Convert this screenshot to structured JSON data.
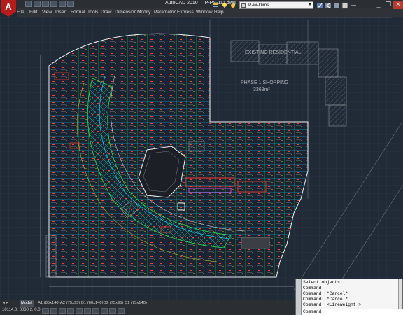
{
  "app": {
    "logo_letter": "A",
    "title": "AutoCAD 2010",
    "file": "P-PS-111.dwg"
  },
  "window_controls": {
    "minimize": "_",
    "restore": "❐",
    "close": "✕"
  },
  "menu": [
    "File",
    "Edit",
    "View",
    "Insert",
    "Format",
    "Tools",
    "Draw",
    "Dimension",
    "Modify",
    "Parametric",
    "Express",
    "Window",
    "Help"
  ],
  "layer": {
    "current": "P-W-Dims"
  },
  "drawing": {
    "label_existing": "EXISTING RESIDENTIAL",
    "label_phase": "PHASE 1 SHOPPING",
    "label_area": "3368m²",
    "colors": {
      "background": "#212b38",
      "cyan": "#00d8ff",
      "green": "#2de04a",
      "yellow": "#e6e020",
      "red": "#ff3b30",
      "magenta": "#ff44ff",
      "white": "#f0f0f0",
      "grey": "#8a8f95"
    }
  },
  "command": {
    "lines": [
      "Select objects:",
      "Command:",
      "Command: *Cancel*",
      "Command: *Cancel*",
      "Command:  <Lineweight >"
    ],
    "prompt": "Command:"
  },
  "tabs": [
    "Model",
    "A1 (85x140)",
    "A2 (75x95)",
    "B1 (60x140)",
    "B2 (75x95)",
    "C1 (75x140)"
  ],
  "status": {
    "coords": "10114.0, 8030.2, 0.0"
  }
}
